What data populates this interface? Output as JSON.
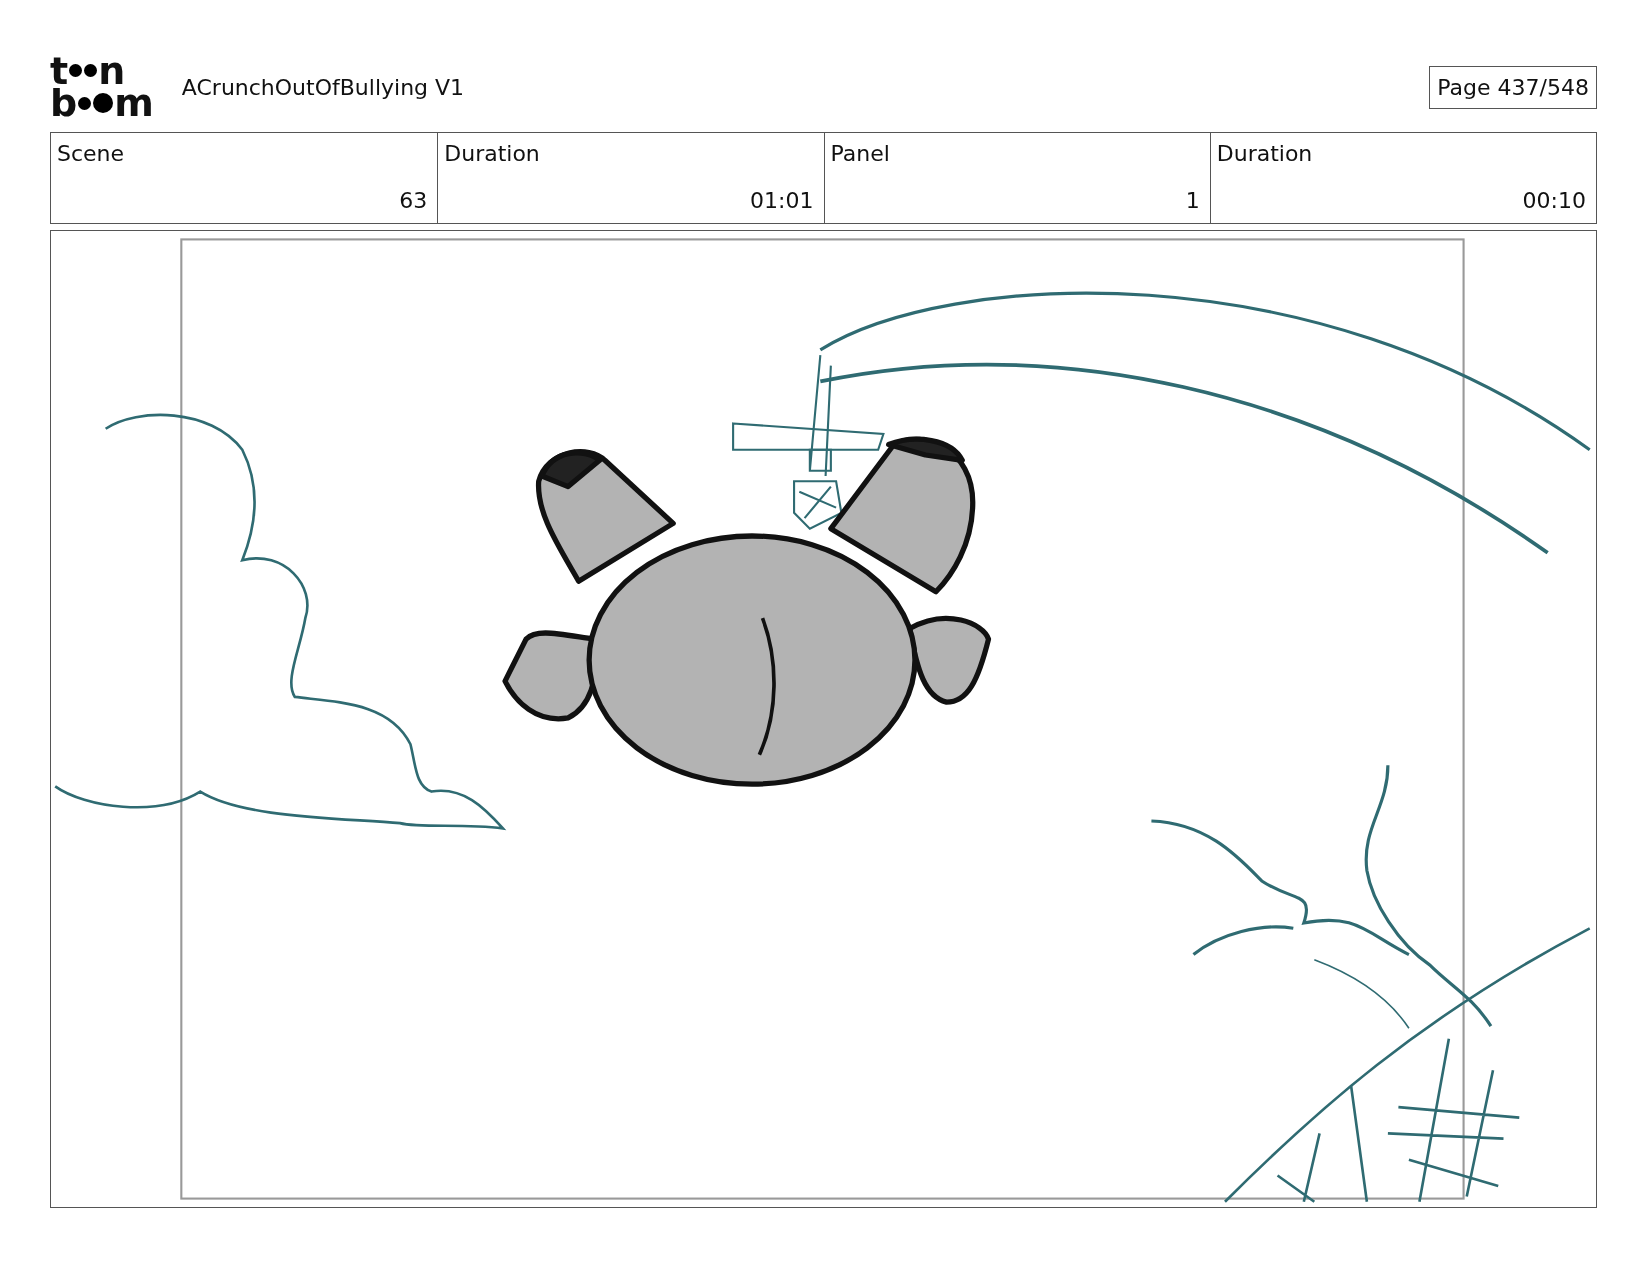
{
  "logo": {
    "lines": [
      [
        "t",
        "n"
      ],
      [
        "b",
        "m"
      ]
    ]
  },
  "title": "ACrunchOutOfBullying V1",
  "page": "Page 437/548",
  "info_table": {
    "headers": [
      "Scene",
      "Duration",
      "Panel",
      "Duration"
    ],
    "values": [
      "63",
      "01:01",
      "1",
      "00:10"
    ]
  }
}
